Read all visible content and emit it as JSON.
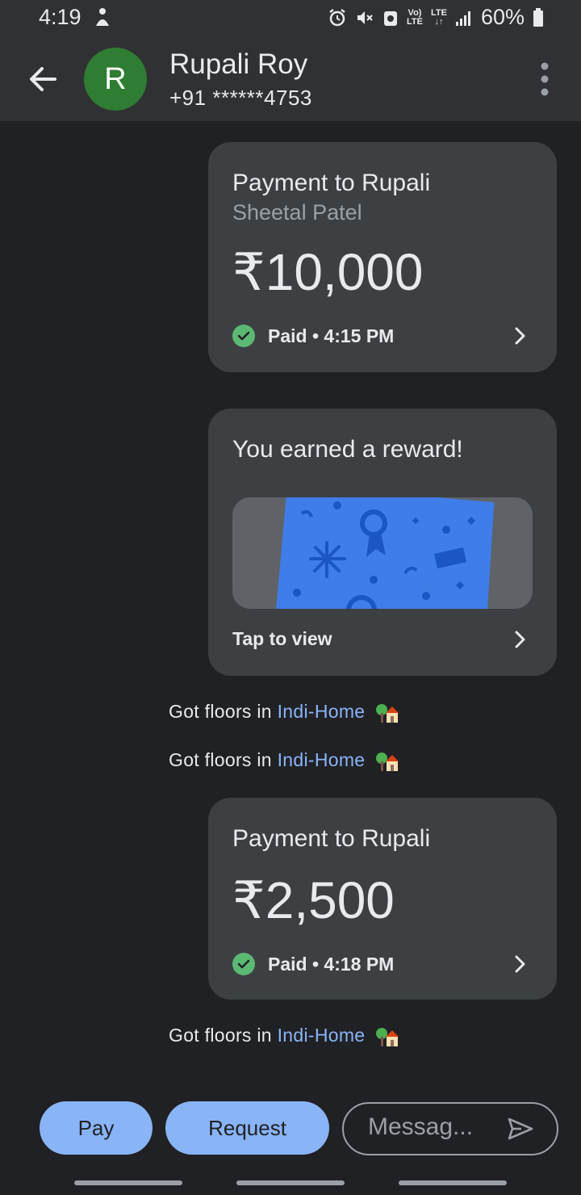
{
  "status_bar": {
    "time": "4:19",
    "battery": "60%",
    "network_top": "Vo)",
    "network_bottom": "LTE",
    "network2_top": "LTE",
    "network2_bottom": "↓↑"
  },
  "contact": {
    "initial": "R",
    "name": "Rupali Roy",
    "phone": "+91 ******4753"
  },
  "payments": [
    {
      "title": "Payment to Rupali",
      "note": "Sheetal Patel",
      "amount": "₹10,000",
      "status": "Paid • 4:15 PM"
    },
    {
      "title": "Payment to Rupali",
      "amount": "₹2,500",
      "status": "Paid • 4:18 PM"
    }
  ],
  "reward": {
    "title": "You earned a reward!",
    "action": "Tap to view"
  },
  "messages": [
    {
      "text": "Got floors in ",
      "link": "Indi-Home"
    },
    {
      "text": "Got floors in ",
      "link": "Indi-Home"
    },
    {
      "text": "Got floors in ",
      "link": "Indi-Home"
    }
  ],
  "composer": {
    "pay_label": "Pay",
    "request_label": "Request",
    "placeholder": "Messag..."
  },
  "colors": {
    "accent": "#8ab4f8",
    "avatar": "#2e7d32",
    "paid": "#5bb974",
    "reward_card": "#3f7de8"
  }
}
